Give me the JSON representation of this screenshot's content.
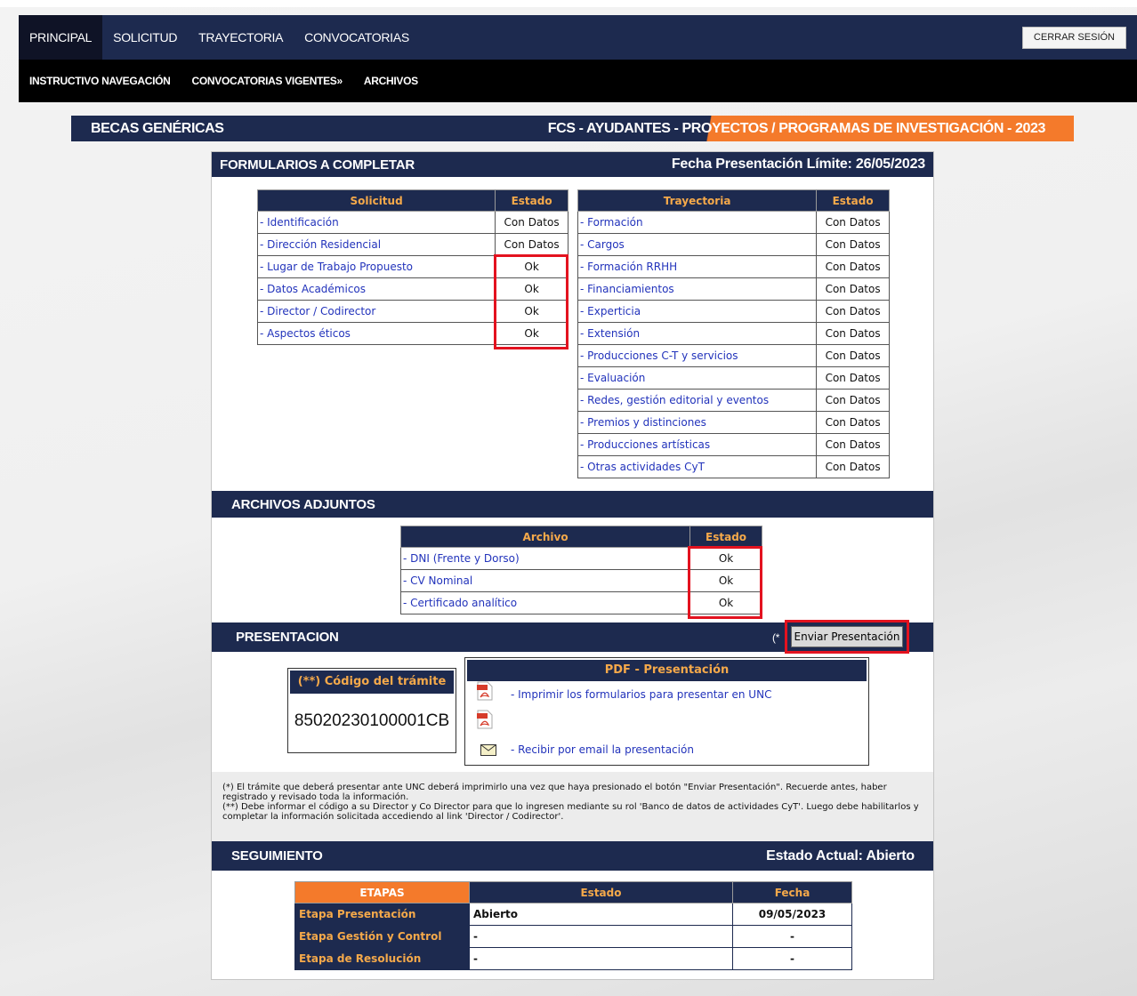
{
  "nav": {
    "primary": [
      "PRINCIPAL",
      "SOLICITUD",
      "TRAYECTORIA",
      "CONVOCATORIAS"
    ],
    "logout": "CERRAR SESIÓN",
    "secondary": [
      "INSTRUCTIVO NAVEGACIÓN",
      "CONVOCATORIAS VIGENTES»",
      "ARCHIVOS"
    ]
  },
  "banner": {
    "left": "BECAS GENÉRICAS",
    "right": "FCS - AYUDANTES - PROYECTOS / PROGRAMAS DE INVESTIGACIÓN - 2023"
  },
  "formularios": {
    "title": "FORMULARIOS A COMPLETAR",
    "deadline": "Fecha Presentación Límite:  26/05/2023",
    "solicitud": {
      "headers": [
        "Solicitud",
        "Estado"
      ],
      "rows": [
        [
          "- Identificación",
          "Con Datos"
        ],
        [
          "- Dirección Residencial",
          "Con Datos"
        ],
        [
          "- Lugar de Trabajo Propuesto",
          "Ok"
        ],
        [
          "- Datos Académicos",
          "Ok"
        ],
        [
          "- Director / Codirector",
          "Ok"
        ],
        [
          "- Aspectos éticos",
          "Ok"
        ]
      ]
    },
    "trayectoria": {
      "headers": [
        "Trayectoria",
        "Estado"
      ],
      "rows": [
        [
          "- Formación",
          "Con Datos"
        ],
        [
          "- Cargos",
          "Con Datos"
        ],
        [
          "- Formación RRHH",
          "Con Datos"
        ],
        [
          "- Financiamientos",
          "Con Datos"
        ],
        [
          "- Experticia",
          "Con Datos"
        ],
        [
          "- Extensión",
          "Con Datos"
        ],
        [
          "- Producciones C-T y servicios",
          "Con Datos"
        ],
        [
          "- Evaluación",
          "Con Datos"
        ],
        [
          "- Redes, gestión editorial y eventos",
          "Con Datos"
        ],
        [
          "- Premios y distinciones",
          "Con Datos"
        ],
        [
          "- Producciones artísticas",
          "Con Datos"
        ],
        [
          "- Otras actividades CyT",
          "Con Datos"
        ]
      ]
    }
  },
  "archivos": {
    "title": "ARCHIVOS ADJUNTOS",
    "headers": [
      "Archivo",
      "Estado"
    ],
    "rows": [
      [
        "- DNI (Frente y Dorso)",
        "Ok"
      ],
      [
        "- CV Nominal",
        "Ok"
      ],
      [
        "- Certificado analítico",
        "Ok"
      ]
    ]
  },
  "presentacion": {
    "title": "PRESENTACION",
    "asterisk": "(*",
    "send_button": "Enviar Presentación",
    "code_header": "(**) Código del trámite",
    "code_value": "85020230100001CB",
    "pdf_header": "PDF - Presentación",
    "print_link": "- Imprimir los formularios para presentar en UNC",
    "email_link": "- Recibir por email la presentación",
    "note1": "(*) El trámite que deberá presentar ante UNC deberá imprimirlo una vez que haya presionado el botón \"Enviar Presentación\". Recuerde antes, haber registrado y revisado toda la información.",
    "note2": "(**) Debe informar el código a su Director y Co Director para que lo ingresen mediante su rol 'Banco de datos de actividades CyT'. Luego debe habilitarlos y completar la información solicitada accediendo al link 'Director / Codirector'."
  },
  "seguimiento": {
    "title": "SEGUIMIENTO",
    "estado": "Estado Actual:  Abierto",
    "headers": [
      "ETAPAS",
      "Estado",
      "Fecha"
    ],
    "rows": [
      [
        "Etapa Presentación",
        "Abierto",
        "09/05/2023"
      ],
      [
        "Etapa Gestión y Control",
        "-",
        "-"
      ],
      [
        "Etapa de Resolución",
        "-",
        "-"
      ]
    ]
  },
  "colors": {
    "navy": "#1d2a4f",
    "orange": "#f47a2b",
    "header_text": "#f5a94a",
    "highlight": "#e3121f"
  }
}
